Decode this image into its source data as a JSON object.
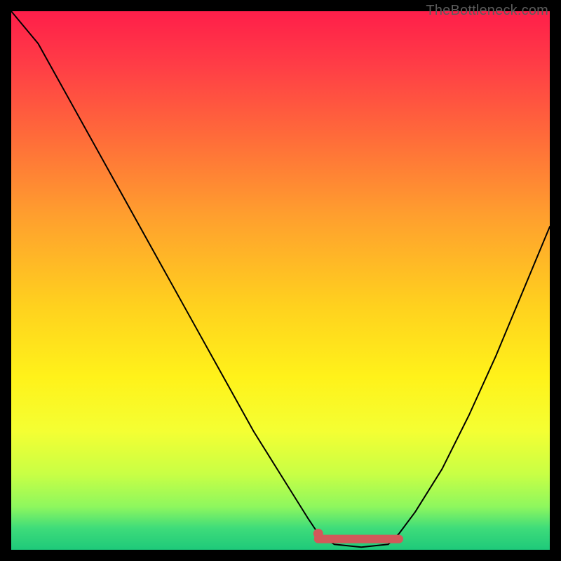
{
  "watermark": "TheBottleneck.com",
  "colors": {
    "curve": "#000000",
    "highlight": "#d15a5a",
    "gradient_top": "#ff1e4a",
    "gradient_bottom": "#1ec97a",
    "frame": "#000000"
  },
  "chart_data": {
    "type": "line",
    "title": "",
    "xlabel": "",
    "ylabel": "",
    "xlim": [
      0,
      100
    ],
    "ylim": [
      0,
      100
    ],
    "series": [
      {
        "name": "bottleneck-curve",
        "x": [
          0,
          5,
          10,
          15,
          20,
          25,
          30,
          35,
          40,
          45,
          50,
          55,
          57,
          60,
          65,
          70,
          72,
          75,
          80,
          85,
          90,
          95,
          100
        ],
        "y": [
          100,
          94,
          85,
          76,
          67,
          58,
          49,
          40,
          31,
          22,
          14,
          6,
          3,
          1,
          0.5,
          1,
          3,
          7,
          15,
          25,
          36,
          48,
          60
        ]
      }
    ],
    "highlight": {
      "name": "optimal-range",
      "x_start": 57,
      "x_end": 72,
      "y": 2,
      "dot_x": 57,
      "dot_y": 3
    }
  }
}
